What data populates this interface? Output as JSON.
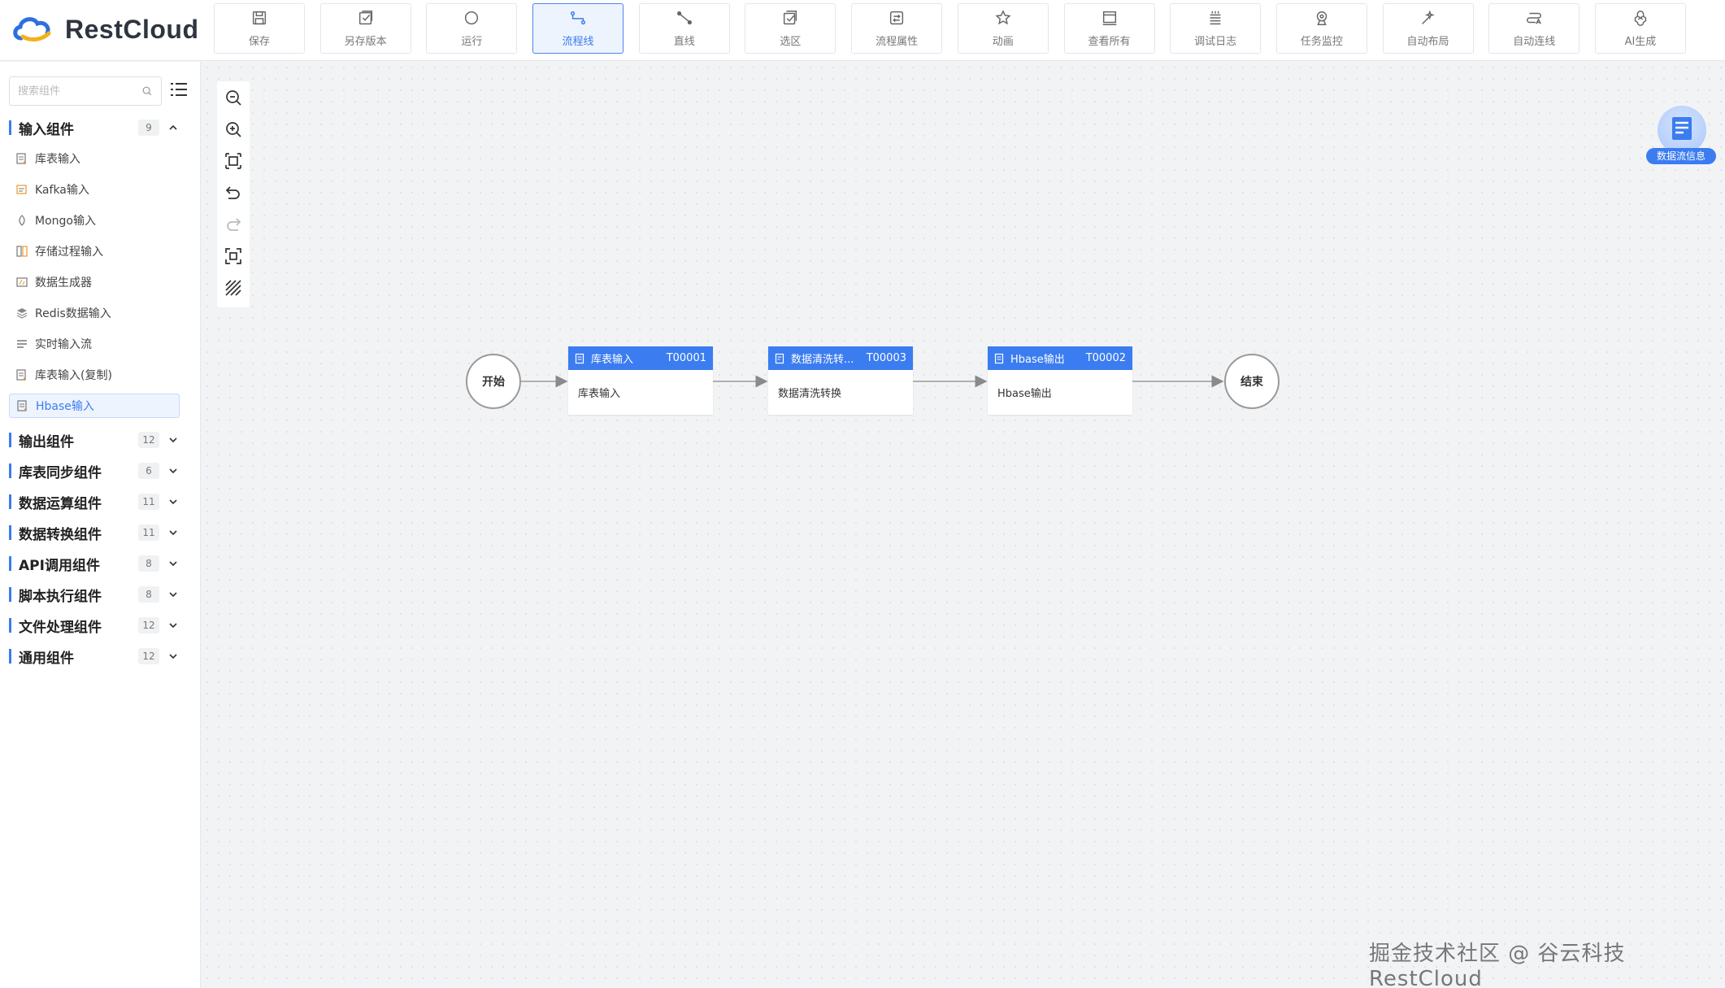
{
  "app": {
    "name": "RestCloud"
  },
  "toolbar": [
    {
      "label": "保存",
      "icon": "save-icon",
      "active": false
    },
    {
      "label": "另存版本",
      "icon": "save-version-icon",
      "active": false
    },
    {
      "label": "运行",
      "icon": "run-icon",
      "active": false
    },
    {
      "label": "流程线",
      "icon": "flow-line-icon",
      "active": true
    },
    {
      "label": "直线",
      "icon": "straight-line-icon",
      "active": false
    },
    {
      "label": "选区",
      "icon": "select-area-icon",
      "active": false
    },
    {
      "label": "流程属性",
      "icon": "flow-properties-icon",
      "active": false
    },
    {
      "label": "动画",
      "icon": "animation-icon",
      "active": false
    },
    {
      "label": "查看所有",
      "icon": "view-all-icon",
      "active": false
    },
    {
      "label": "调试日志",
      "icon": "debug-log-icon",
      "active": false
    },
    {
      "label": "任务监控",
      "icon": "task-monitor-icon",
      "active": false
    },
    {
      "label": "自动布局",
      "icon": "auto-layout-icon",
      "active": false
    },
    {
      "label": "自动连线",
      "icon": "auto-connect-icon",
      "active": false
    },
    {
      "label": "AI生成",
      "icon": "ai-generate-icon",
      "active": false
    }
  ],
  "sidebar": {
    "search_placeholder": "搜索组件",
    "groups": [
      {
        "title": "输入组件",
        "count": "9",
        "expanded": true
      },
      {
        "title": "输出组件",
        "count": "12",
        "expanded": false
      },
      {
        "title": "库表同步组件",
        "count": "6",
        "expanded": false
      },
      {
        "title": "数据运算组件",
        "count": "11",
        "expanded": false
      },
      {
        "title": "数据转换组件",
        "count": "11",
        "expanded": false
      },
      {
        "title": "API调用组件",
        "count": "8",
        "expanded": false
      },
      {
        "title": "脚本执行组件",
        "count": "8",
        "expanded": false
      },
      {
        "title": "文件处理组件",
        "count": "12",
        "expanded": false
      },
      {
        "title": "通用组件",
        "count": "12",
        "expanded": false
      }
    ],
    "input_items": [
      {
        "label": "库表输入",
        "icon": "table-input-icon"
      },
      {
        "label": "Kafka输入",
        "icon": "kafka-input-icon"
      },
      {
        "label": "Mongo输入",
        "icon": "mongo-input-icon"
      },
      {
        "label": "存储过程输入",
        "icon": "stored-procedure-icon"
      },
      {
        "label": "数据生成器",
        "icon": "data-generator-icon"
      },
      {
        "label": "Redis数据输入",
        "icon": "redis-input-icon"
      },
      {
        "label": "实时输入流",
        "icon": "realtime-stream-icon"
      },
      {
        "label": "库表输入(复制)",
        "icon": "table-input-copy-icon"
      },
      {
        "label": "Hbase输入",
        "icon": "hbase-input-icon",
        "selected": true
      }
    ]
  },
  "canvas_tools": [
    {
      "name": "zoom-out-icon",
      "disabled": false
    },
    {
      "name": "zoom-in-icon",
      "disabled": false
    },
    {
      "name": "fit-view-icon",
      "disabled": false
    },
    {
      "name": "undo-icon",
      "disabled": false
    },
    {
      "name": "redo-icon",
      "disabled": true
    },
    {
      "name": "fullscreen-icon",
      "disabled": false
    },
    {
      "name": "grid-pattern-icon",
      "disabled": false
    }
  ],
  "flow": {
    "start_label": "开始",
    "end_label": "结束",
    "nodes": [
      {
        "name": "库表输入",
        "id": "T00001",
        "desc": "库表输入"
      },
      {
        "name": "数据清洗转...",
        "id": "T00003",
        "desc": "数据清洗转换"
      },
      {
        "name": "Hbase输出",
        "id": "T00002",
        "desc": "Hbase输出"
      }
    ]
  },
  "flow_info": {
    "label": "数据流信息"
  },
  "watermark": "掘金技术社区 @ 谷云科技RestCloud",
  "colors": {
    "accent": "#3b7cf0",
    "node_header": "#3b7cf0"
  }
}
